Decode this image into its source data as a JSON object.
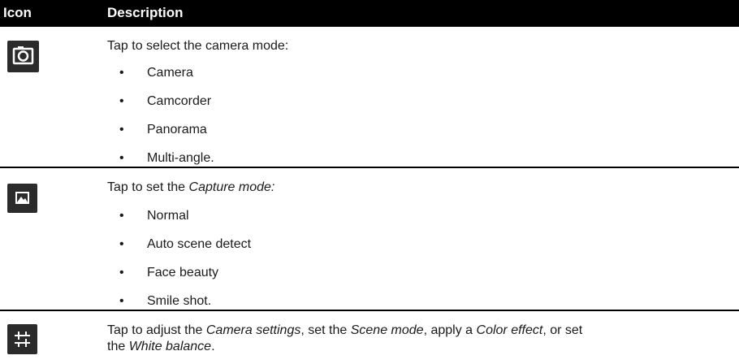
{
  "header": {
    "icon_label": "Icon",
    "description_label": "Description"
  },
  "rows": [
    {
      "icon": "camera-icon",
      "intro": "Tap to select the camera mode:",
      "items": [
        "Camera",
        "Camcorder",
        "Panorama",
        "Multi-angle."
      ]
    },
    {
      "icon": "picture-icon",
      "intro_prefix": "Tap to set the ",
      "intro_em": "Capture mode",
      "intro_suffix": ":",
      "items": [
        "Normal",
        "Auto scene detect",
        "Face beauty",
        "Smile shot."
      ]
    },
    {
      "icon": "settings-sliders-icon",
      "parts": {
        "p1": "Tap to adjust the ",
        "e1": "Camera settings",
        "p2": ", set the ",
        "e2": "Scene mode",
        "p3": ", apply a ",
        "e3": "Color effect",
        "p4": ", or set",
        "p5": "the ",
        "e4": "White balance",
        "p6": "."
      }
    }
  ],
  "colors": {
    "header_bg": "#000000",
    "icon_bg": "#2b2b2b",
    "divider": "#000000"
  }
}
